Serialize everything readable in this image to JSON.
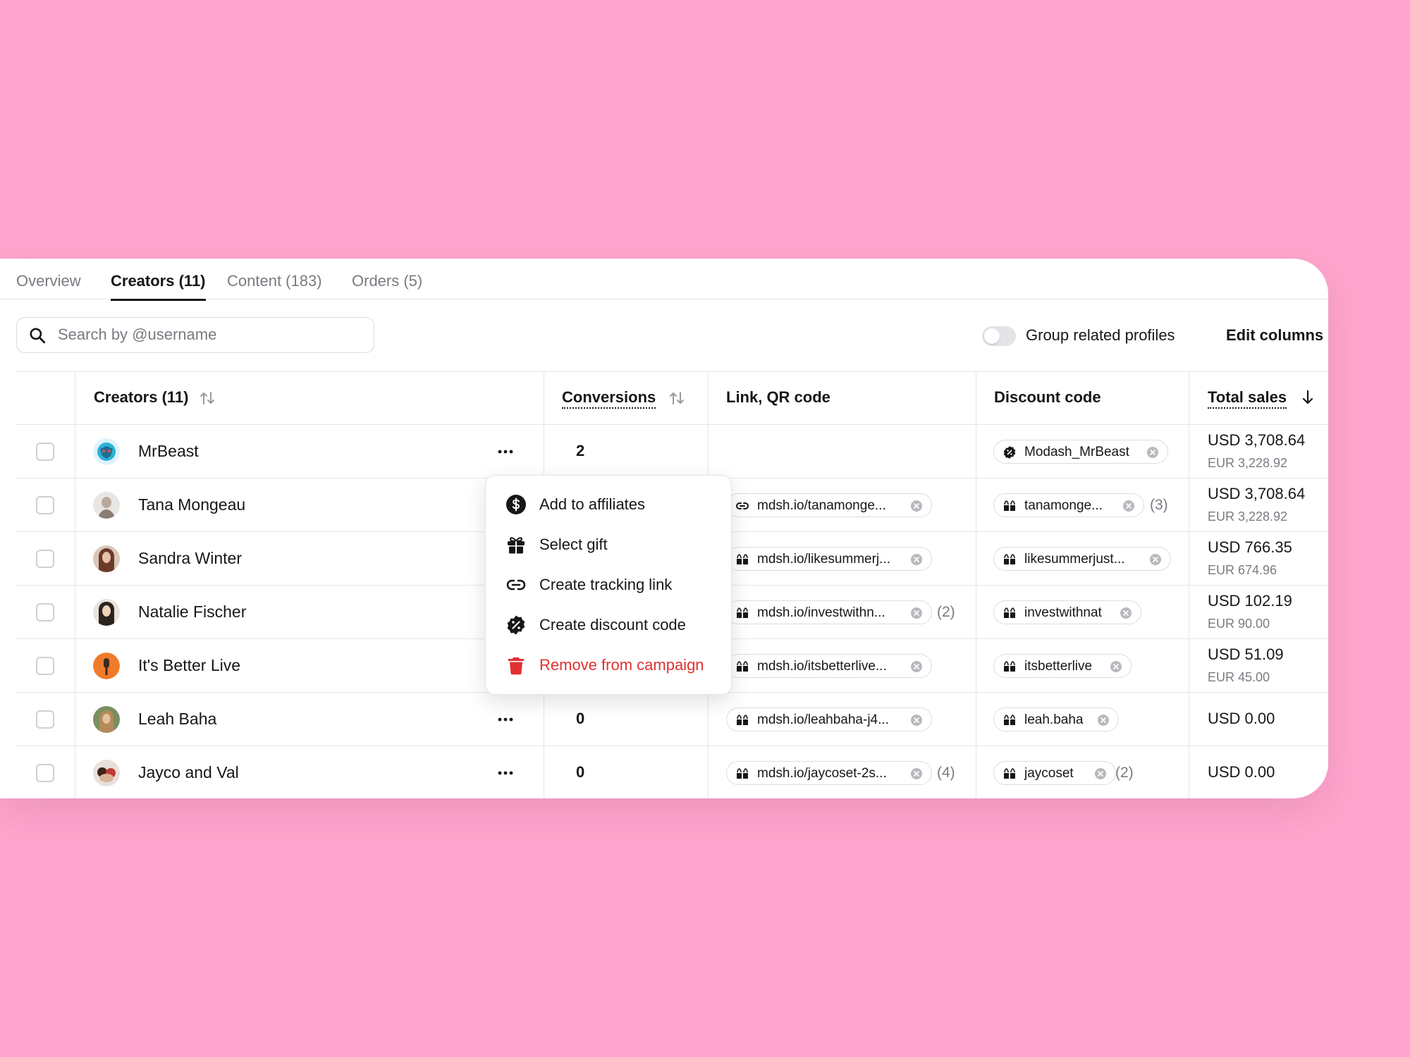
{
  "tabs": [
    {
      "label": "Overview"
    },
    {
      "label": "Creators (11)"
    },
    {
      "label": "Content (183)"
    },
    {
      "label": "Orders (5)"
    }
  ],
  "search": {
    "placeholder": "Search by @username",
    "icon": "search-icon"
  },
  "toolbar": {
    "group_label": "Group related profiles",
    "group_toggle_on": false,
    "edit_columns": "Edit columns"
  },
  "columns": {
    "creators": "Creators (11)",
    "conversions": "Conversions",
    "link": "Link, QR code",
    "discount": "Discount code",
    "sales": "Total sales"
  },
  "rows": [
    {
      "name": "MrBeast",
      "conversions": "2",
      "link": null,
      "discount": {
        "text": "Modash_MrBeast",
        "icon": "discount-badge-icon"
      },
      "usd": "USD 3,708.64",
      "eur": "EUR 3,228.92"
    },
    {
      "name": "Tana Mongeau",
      "conversions": "",
      "link": {
        "text": "mdsh.io/tanamonge...",
        "icon": "link-icon"
      },
      "discount": {
        "text": "tanamonge...",
        "icon": "shopify-icon",
        "count": "(3)"
      },
      "usd": "USD 3,708.64",
      "eur": "EUR 3,228.92"
    },
    {
      "name": "Sandra Winter",
      "conversions": "",
      "link": {
        "text": "mdsh.io/likesummerj...",
        "icon": "shopify-icon"
      },
      "discount": {
        "text": "likesummerjust...",
        "icon": "shopify-icon"
      },
      "usd": "USD 766.35",
      "eur": "EUR 674.96"
    },
    {
      "name": "Natalie Fischer",
      "conversions": "",
      "link": {
        "text": "mdsh.io/investwithn...",
        "icon": "shopify-icon",
        "count": "(2)"
      },
      "discount": {
        "text": "investwithnat",
        "icon": "shopify-icon"
      },
      "usd": "USD 102.19",
      "eur": "EUR 90.00"
    },
    {
      "name": "It's Better Live",
      "conversions": "",
      "link": {
        "text": "mdsh.io/itsbetterlive...",
        "icon": "shopify-icon"
      },
      "discount": {
        "text": "itsbetterlive",
        "icon": "shopify-icon"
      },
      "usd": "USD 51.09",
      "eur": "EUR 45.00"
    },
    {
      "name": "Leah Baha",
      "conversions": "0",
      "link": {
        "text": "mdsh.io/leahbaha-j4...",
        "icon": "shopify-icon"
      },
      "discount": {
        "text": "leah.baha",
        "icon": "shopify-icon"
      },
      "usd": "USD 0.00",
      "eur": ""
    },
    {
      "name": "Jayco and Val",
      "conversions": "0",
      "link": {
        "text": "mdsh.io/jaycoset-2s...",
        "icon": "shopify-icon",
        "count": "(4)"
      },
      "discount": {
        "text": "jaycoset",
        "icon": "shopify-icon",
        "count": "(2)"
      },
      "usd": "USD 0.00",
      "eur": ""
    }
  ],
  "menu": {
    "items": [
      {
        "label": "Add to affiliates",
        "icon": "dollar-icon"
      },
      {
        "label": "Select gift",
        "icon": "gift-icon"
      },
      {
        "label": "Create tracking link",
        "icon": "link-icon"
      },
      {
        "label": "Create discount code",
        "icon": "discount-badge-icon"
      },
      {
        "label": "Remove from campaign",
        "icon": "trash-icon",
        "danger": true
      }
    ]
  },
  "colors": {
    "background": "#fea5cd",
    "danger": "#e03131",
    "text": "#17171a",
    "muted": "#7a7a82"
  }
}
